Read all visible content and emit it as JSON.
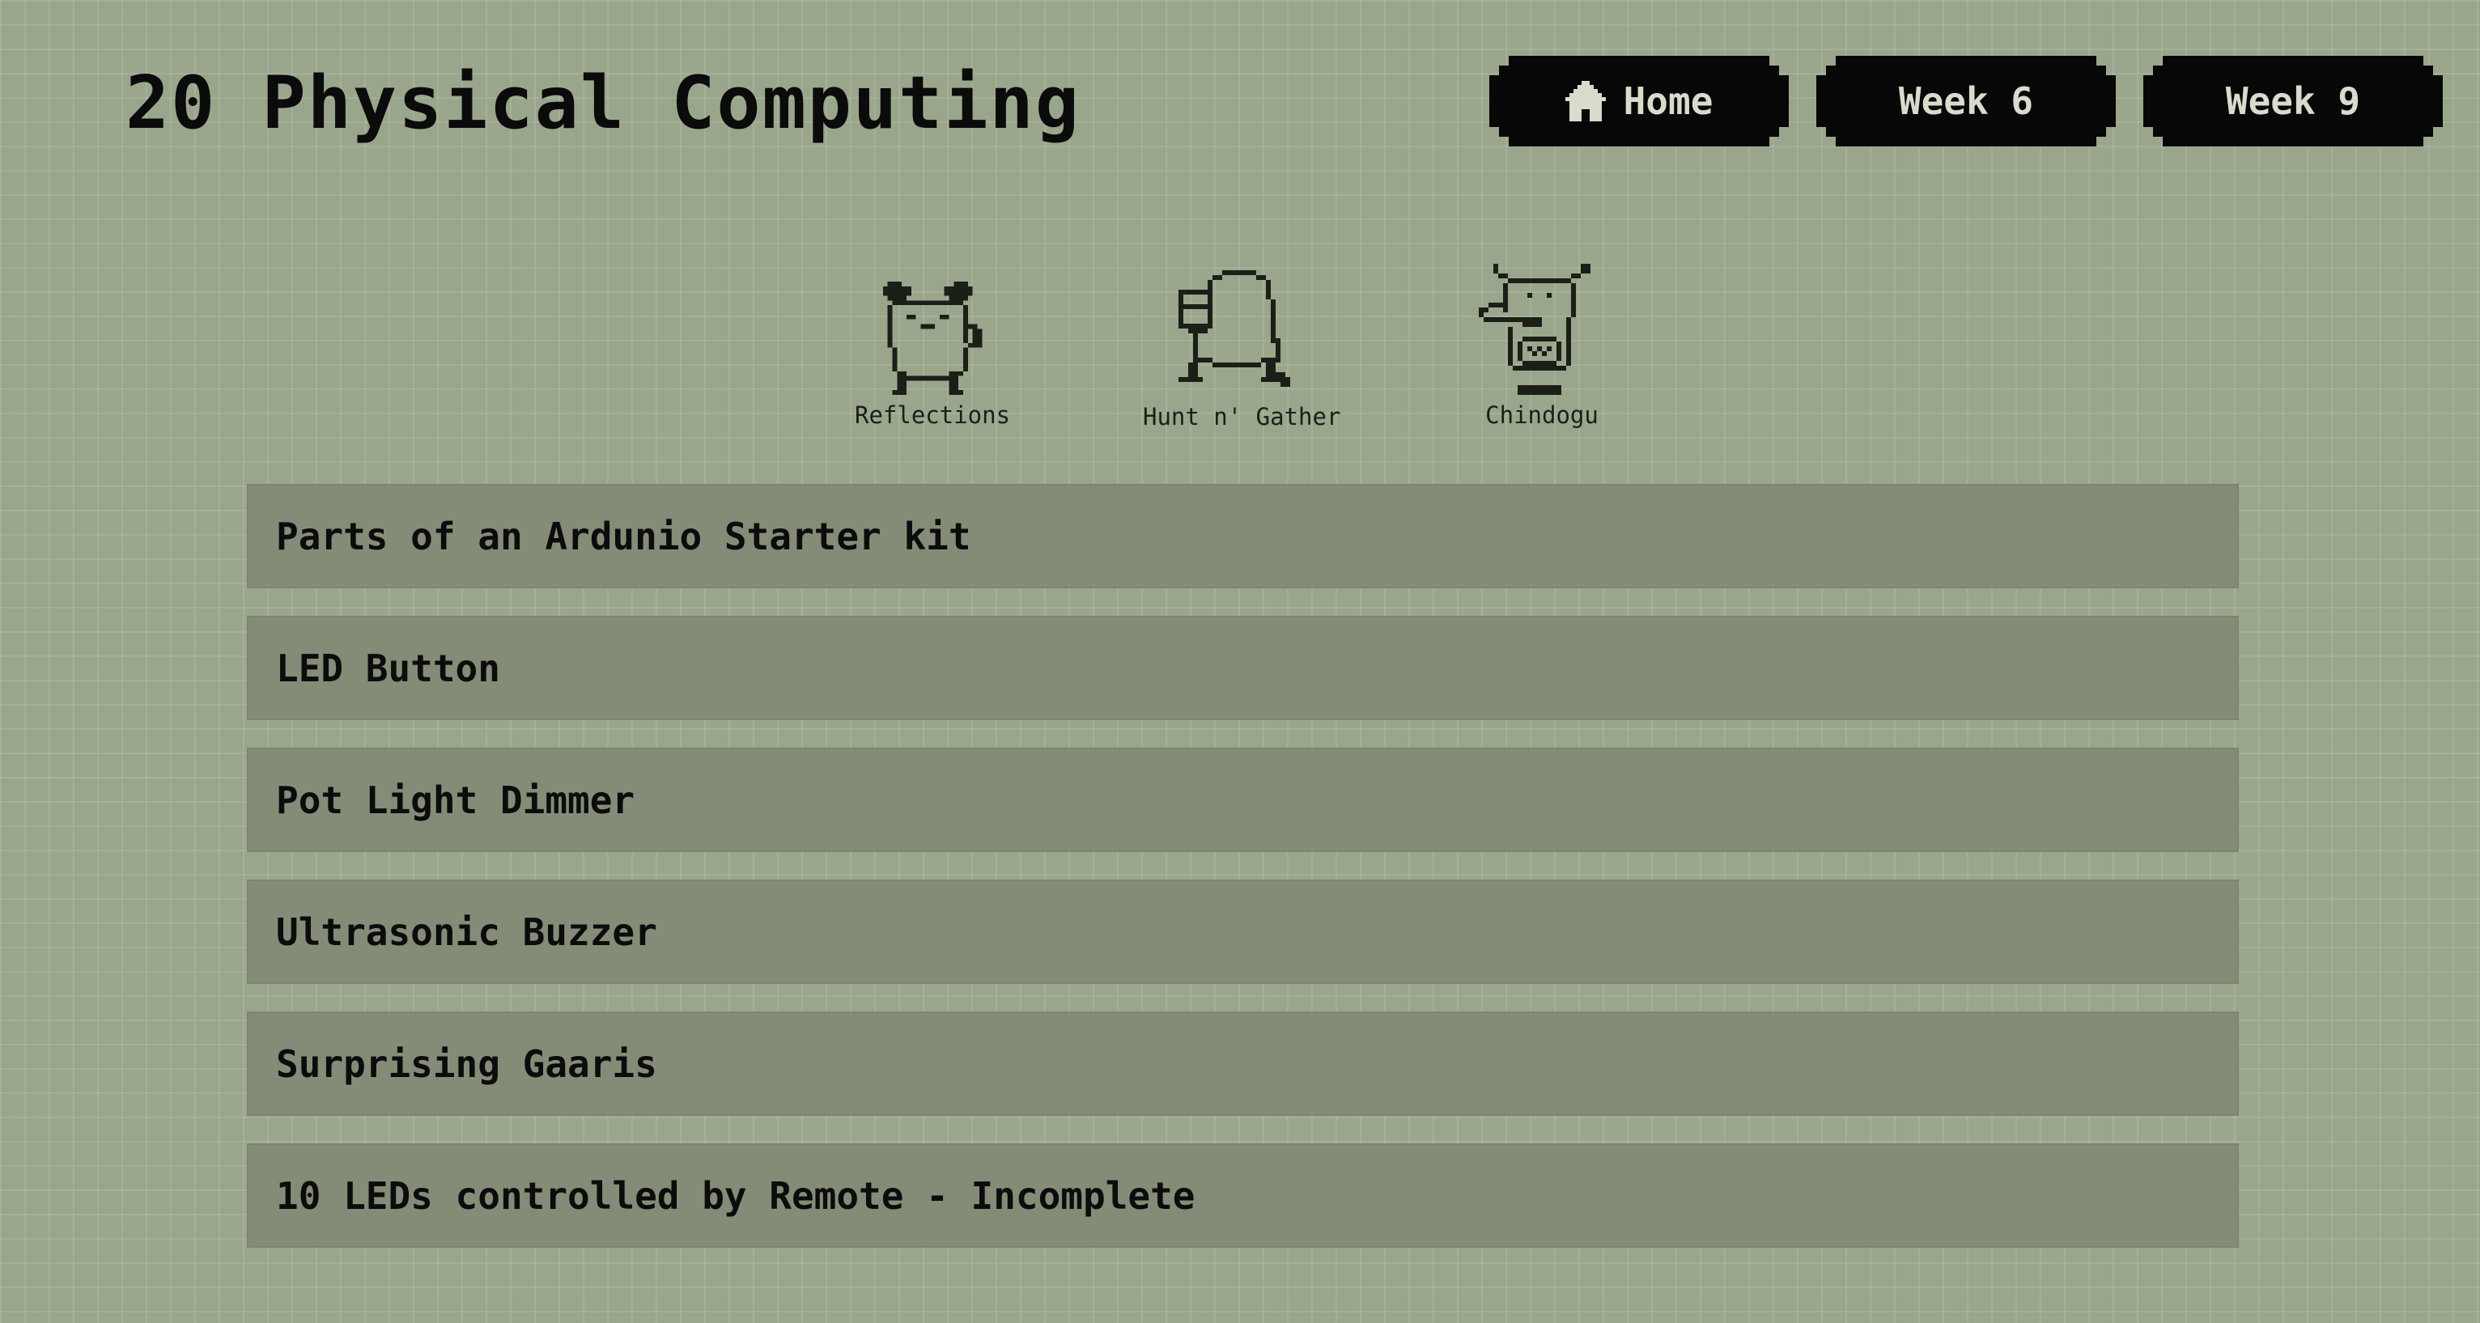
{
  "header": {
    "title": "20 Physical Computing"
  },
  "nav": [
    {
      "label": "Home",
      "icon": "home-icon"
    },
    {
      "label": "Week 6"
    },
    {
      "label": "Week 9"
    }
  ],
  "sprites": [
    {
      "label": "Reflections",
      "icon": "pixel-creature-antlers-icon"
    },
    {
      "label": "Hunt n' Gather",
      "icon": "pixel-creature-mask-icon"
    },
    {
      "label": "Chindogu",
      "icon": "pixel-creature-beak-icon"
    }
  ],
  "projects": [
    "Parts of an Ardunio Starter kit",
    "LED Button",
    "Pot Light Dimmer",
    "Ultrasonic Buzzer",
    "Surprising Gaaris",
    "10 LEDs controlled by Remote - Incomplete"
  ],
  "colors": {
    "background": "#9aa68c",
    "grid_line": "#b0baa3",
    "panel": "#848c78",
    "button": "#070707",
    "button_text": "#d7dccd",
    "text": "#0b0b0b"
  }
}
